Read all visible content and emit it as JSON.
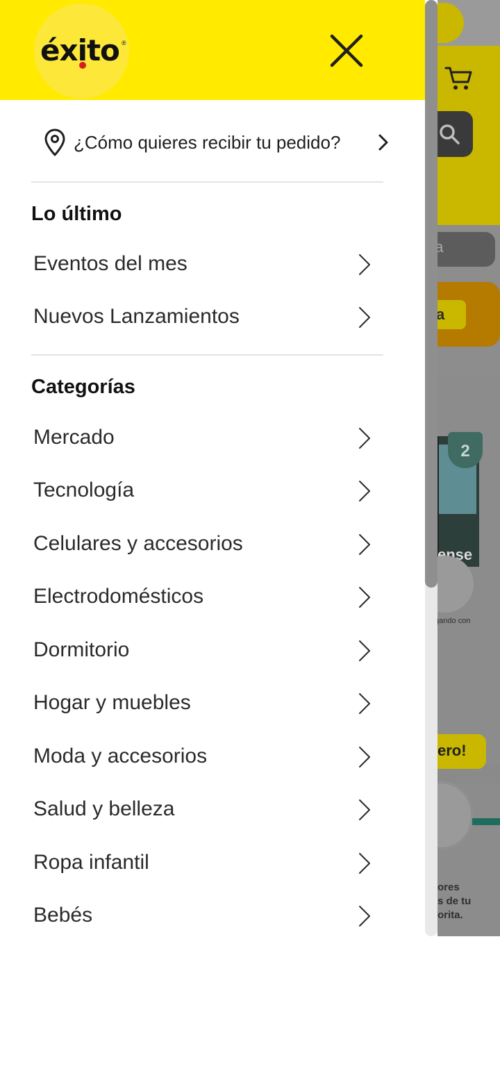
{
  "background": {
    "pill_text": "da",
    "banner_tag": "a",
    "shield_number": "2",
    "brand_fragment": "ense",
    "small_text": "gando con",
    "hero_tag": "ero!",
    "promo_text": "ores\ns de tu\norita."
  },
  "header": {
    "logo_text": "éxito",
    "logo_reg": "®"
  },
  "delivery": {
    "label": "¿Cómo quieres recibir tu pedido?"
  },
  "sections": [
    {
      "title": "Lo último",
      "items": [
        {
          "label": "Eventos del mes"
        },
        {
          "label": "Nuevos Lanzamientos"
        }
      ]
    },
    {
      "title": "Categorías",
      "items": [
        {
          "label": "Mercado"
        },
        {
          "label": "Tecnología"
        },
        {
          "label": "Celulares y accesorios"
        },
        {
          "label": "Electrodomésticos"
        },
        {
          "label": "Dormitorio"
        },
        {
          "label": "Hogar y muebles"
        },
        {
          "label": "Moda y accesorios"
        },
        {
          "label": "Salud y belleza"
        },
        {
          "label": "Ropa infantil"
        },
        {
          "label": "Bebés"
        }
      ]
    }
  ],
  "colors": {
    "brand_yellow": "#ffea00",
    "logo_red": "#d81e1e"
  }
}
